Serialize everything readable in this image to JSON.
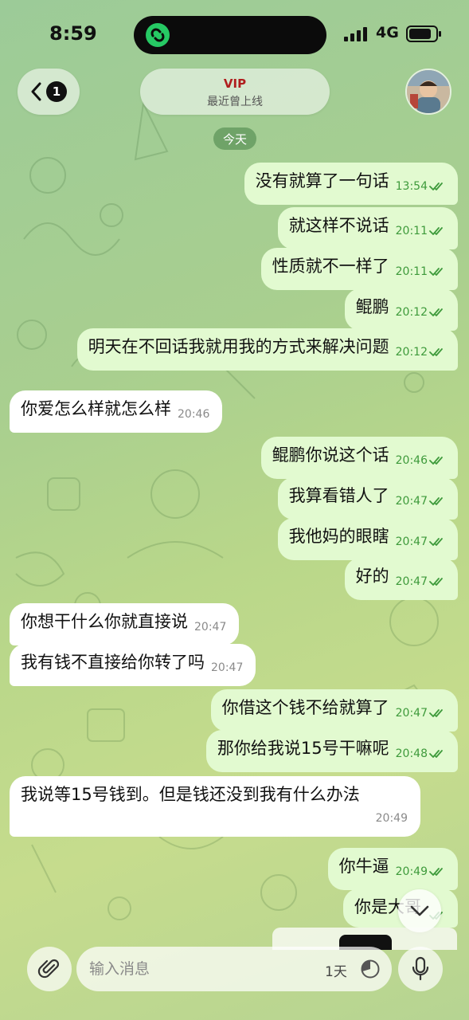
{
  "status_bar": {
    "time": "8:59",
    "network": "4G",
    "battery_level": 0.85
  },
  "header": {
    "back_badge": "1",
    "contact_name": "VIP",
    "contact_status": "最近曾上线"
  },
  "date_divider": "今天",
  "messages": [
    {
      "dir": "out",
      "text": "没有就算了一句话",
      "time": "13:54",
      "read": true
    },
    {
      "dir": "out",
      "text": "就这样不说话",
      "time": "20:11",
      "read": true
    },
    {
      "dir": "out",
      "text": "性质就不一样了",
      "time": "20:11",
      "read": true
    },
    {
      "dir": "out",
      "text": "鲲鹏",
      "time": "20:12",
      "read": true
    },
    {
      "dir": "out",
      "text": "明天在不回话我就用我的方式来解决问题",
      "time": "20:12",
      "read": true
    },
    {
      "dir": "in",
      "text": "你爱怎么样就怎么样",
      "time": "20:46"
    },
    {
      "dir": "out",
      "text": "鲲鹏你说这个话",
      "time": "20:46",
      "read": true
    },
    {
      "dir": "out",
      "text": "我算看错人了",
      "time": "20:47",
      "read": true
    },
    {
      "dir": "out",
      "text": "我他妈的眼瞎",
      "time": "20:47",
      "read": true
    },
    {
      "dir": "out",
      "text": "好的",
      "time": "20:47",
      "read": true
    },
    {
      "dir": "in",
      "text": "你想干什么你就直接说",
      "time": "20:47"
    },
    {
      "dir": "in",
      "text": "我有钱不直接给你转了吗",
      "time": "20:47"
    },
    {
      "dir": "out",
      "text": "你借这个钱不给就算了",
      "time": "20:47",
      "read": true
    },
    {
      "dir": "out",
      "text": "那你给我说15号干嘛呢",
      "time": "20:48",
      "read": true
    },
    {
      "dir": "in",
      "text": "我说等15号钱到。但是钱还没到我有什么办法",
      "time": "20:49"
    },
    {
      "dir": "out",
      "text": "你牛逼",
      "time": "20:49",
      "read": true
    },
    {
      "dir": "out",
      "text": "你是大哥",
      "time": "",
      "read": true
    }
  ],
  "composer": {
    "placeholder": "输入消息",
    "timer_label": "1天"
  },
  "icons": {
    "back": "chevron-left-icon",
    "attach": "paperclip-icon",
    "timer": "timer-icon",
    "mic": "microphone-icon",
    "scroll": "chevron-down-icon",
    "read": "double-check-icon"
  },
  "colors": {
    "outgoing_bubble": "#e2fad0",
    "incoming_bubble": "#ffffff",
    "tick_green": "#3e9a3b",
    "vip_red": "#b01e1e"
  }
}
